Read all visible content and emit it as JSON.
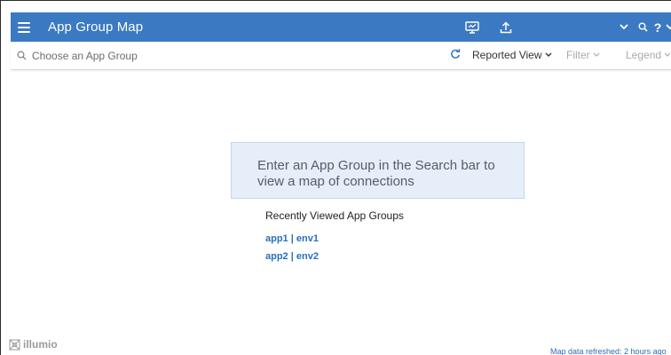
{
  "header": {
    "title": "App Group Map",
    "icons": [
      "menu-icon",
      "monitor-icon",
      "upload-icon",
      "chevron-down-icon",
      "search-icon",
      "help-icon"
    ],
    "help_label": "?"
  },
  "toolbar": {
    "search_placeholder": "Choose an App Group",
    "view_label": "Reported View",
    "filter_label": "Filter",
    "legend_label": "Legend"
  },
  "main": {
    "prompt": "Enter an App Group in the Search bar to view a map of connections",
    "recent_title": "Recently Viewed App Groups",
    "recent_items": [
      {
        "label": "app1 | env1"
      },
      {
        "label": "app2 | env2"
      }
    ]
  },
  "footer": {
    "logo_text": "illumio",
    "refreshed_text": "Map data refreshed: 2 hours ago"
  },
  "colors": {
    "header_bg": "#3b79c3",
    "link": "#2a6ebb",
    "prompt_bg": "#e6eef9"
  }
}
